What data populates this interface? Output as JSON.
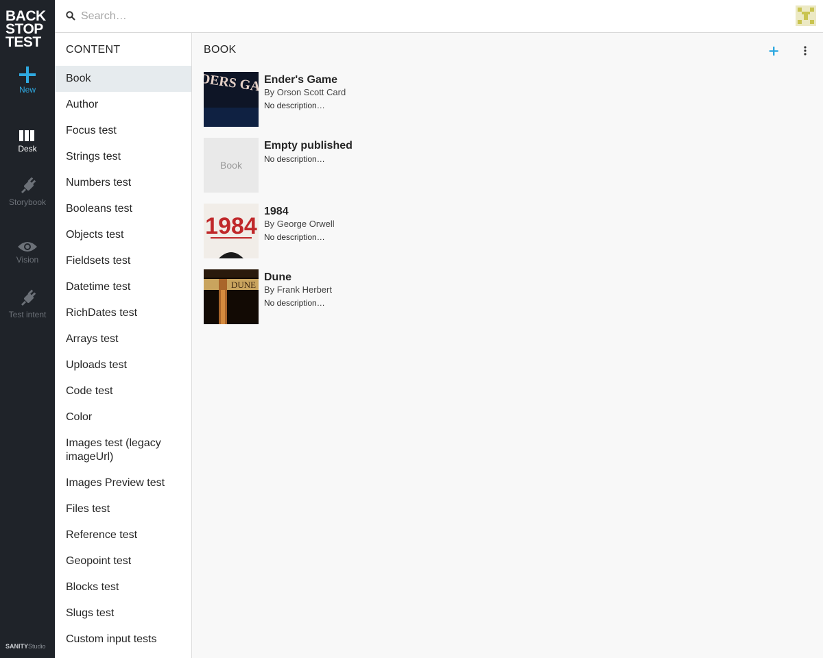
{
  "logo": {
    "lines": [
      "BACK",
      "STOP",
      "TEST"
    ]
  },
  "tools": {
    "new": "New",
    "desk": "Desk",
    "storybook": "Storybook",
    "vision": "Vision",
    "test_intent": "Test intent"
  },
  "brand": {
    "sanity": "SANITY",
    "studio": "Studio"
  },
  "search": {
    "placeholder": "Search…"
  },
  "content_pane": {
    "title": "CONTENT",
    "items": [
      "Book",
      "Author",
      "Focus test",
      "Strings test",
      "Numbers test",
      "Booleans test",
      "Objects test",
      "Fieldsets test",
      "Datetime test",
      "RichDates test",
      "Arrays test",
      "Uploads test",
      "Code test",
      "Color",
      "Images test (legacy imageUrl)",
      "Images Preview test",
      "Files test",
      "Reference test",
      "Geopoint test",
      "Blocks test",
      "Slugs test",
      "Custom input tests"
    ],
    "selected": "Book"
  },
  "book_pane": {
    "title": "BOOK",
    "documents": [
      {
        "title": "Ender's Game",
        "subtitle": "By Orson Scott Card",
        "description": "No description…",
        "cover_text": "ENDERS GAME"
      },
      {
        "title": "Empty published",
        "subtitle": "",
        "description": "No description…",
        "cover_text": "Book"
      },
      {
        "title": "1984",
        "subtitle": "By George Orwell",
        "description": "No description…",
        "cover_text": "1984"
      },
      {
        "title": "Dune",
        "subtitle": "By Frank Herbert",
        "description": "No description…",
        "cover_text": "DUNE"
      }
    ]
  },
  "colors": {
    "rail": "#1f2329",
    "accent": "#2fa9e0",
    "selected_bg": "#e6ebee"
  }
}
